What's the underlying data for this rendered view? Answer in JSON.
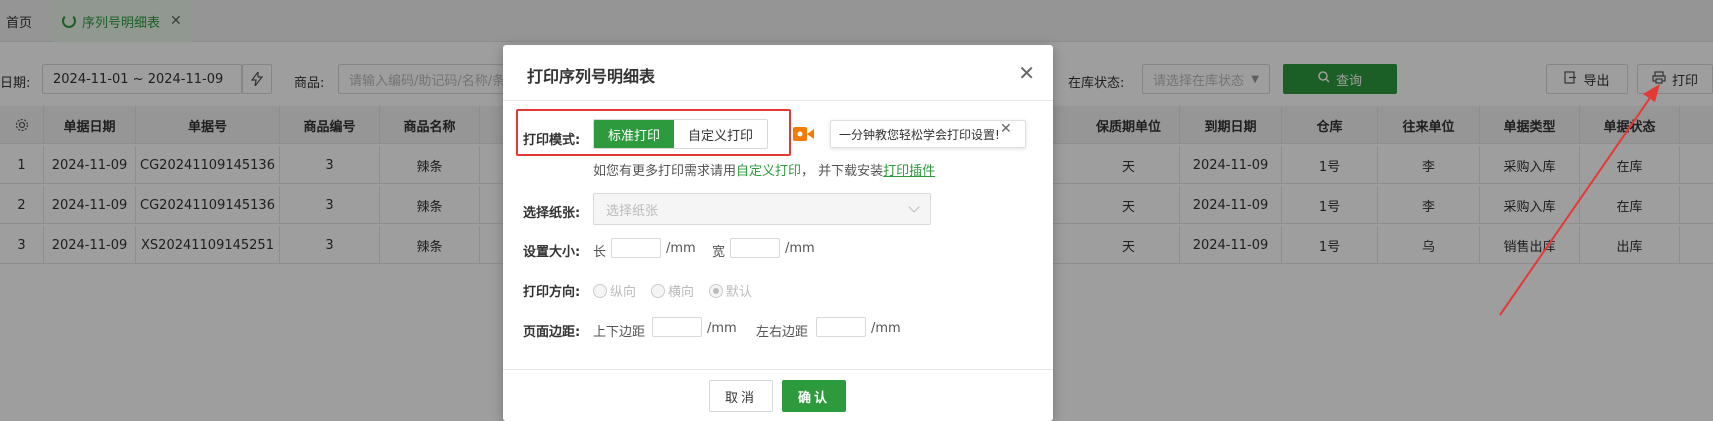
{
  "tabs": {
    "home": "首页",
    "active": "序列号明细表"
  },
  "filters": {
    "date_label": "日期:",
    "date_value": "2024-11-01 ~ 2024-11-09",
    "product_label": "商品:",
    "product_placeholder": "请输入编码/助记码/名称/条",
    "stock_label": "在库状态:",
    "stock_placeholder": "请选择在库状态",
    "query_label": "查询",
    "export_label": "导出",
    "print_label": "打印"
  },
  "table": {
    "headers": [
      "",
      "单据日期",
      "单据号",
      "商品编号",
      "商品名称",
      "保质期单位",
      "到期日期",
      "仓库",
      "往来单位",
      "单据类型",
      "单据状态"
    ],
    "rows": [
      [
        "1",
        "2024-11-09",
        "CG20241109145136",
        "3",
        "辣条",
        "天",
        "2024-11-09",
        "1号",
        "李",
        "采购入库",
        "在库"
      ],
      [
        "2",
        "2024-11-09",
        "CG20241109145136",
        "3",
        "辣条",
        "天",
        "2024-11-09",
        "1号",
        "李",
        "采购入库",
        "在库"
      ],
      [
        "3",
        "2024-11-09",
        "XS20241109145251",
        "3",
        "辣条",
        "天",
        "2024-11-09",
        "1号",
        "乌",
        "销售出库",
        "出库"
      ]
    ]
  },
  "modal": {
    "title": "打印序列号明细表",
    "print_mode_label": "打印模式:",
    "mode_standard": "标准打印",
    "mode_custom": "自定义打印",
    "tip_text": "一分钟教您轻松学会打印设置!",
    "hint_prefix": "如您有更多打印需求请用",
    "hint_custom_link": "自定义打印",
    "hint_middle": "，  并下载安装",
    "hint_plugin_link": "打印插件",
    "paper_label": "选择纸张:",
    "paper_placeholder": "选择纸张",
    "size_label": "设置大小:",
    "size_length": "长",
    "size_width": "宽",
    "unit_mm": "/mm",
    "direction_label": "打印方向:",
    "dir_portrait": "纵向",
    "dir_landscape": "横向",
    "dir_default": "默认",
    "margin_label": "页面边距:",
    "margin_tb": "上下边距",
    "margin_lr": "左右边距",
    "cancel": "取消",
    "confirm": "确认"
  },
  "colors": {
    "primary_green": "#2e9a3e",
    "annotation_red": "#e53935",
    "video_orange": "#f57c00"
  }
}
